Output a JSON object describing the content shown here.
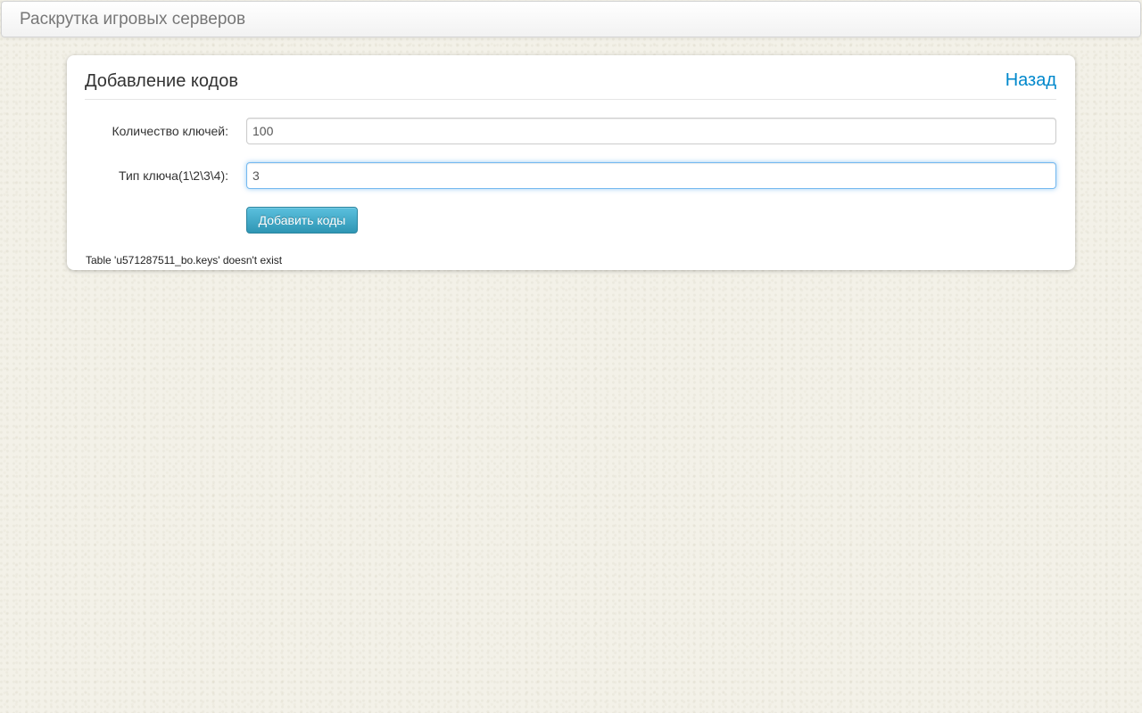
{
  "navbar": {
    "brand": "Раскрутка игровых серверов"
  },
  "panel": {
    "title": "Добавление кодов",
    "back_label": "Назад"
  },
  "form": {
    "fields": [
      {
        "label": "Количество ключей:",
        "value": "100"
      },
      {
        "label": "Тип ключа(1\\2\\3\\4):",
        "value": "3"
      }
    ],
    "submit_label": "Добавить коды"
  },
  "message": {
    "error": "Table 'u571287511_bo.keys' doesn't exist"
  },
  "colors": {
    "background": "#f3f1e8",
    "link": "#0088cc",
    "button_top": "#5bc0de",
    "button_bottom": "#2f96b4",
    "focus_glow": "#52a8ec"
  }
}
